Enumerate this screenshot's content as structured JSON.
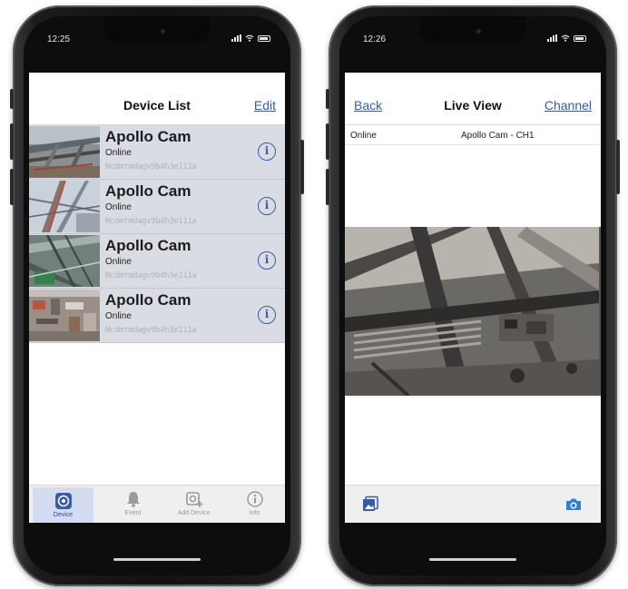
{
  "left_phone": {
    "status_time": "12:25",
    "nav": {
      "title": "Device List",
      "edit_label": "Edit"
    },
    "devices": [
      {
        "name": "Apollo Cam",
        "status": "Online",
        "id": "Ncdmtmdagv9b4h3e111a",
        "thumb_icon": "construction-scaffold-thumbnail"
      },
      {
        "name": "Apollo Cam",
        "status": "Online",
        "id": "Ncdmtmdagv9b4h3e111a",
        "thumb_icon": "tower-crane-thumbnail"
      },
      {
        "name": "Apollo Cam",
        "status": "Online",
        "id": "Ncdmtmdagv9b4h3e111a",
        "thumb_icon": "steel-beams-thumbnail"
      },
      {
        "name": "Apollo Cam",
        "status": "Online",
        "id": "Ncdmtmdagv9b4h3e111a",
        "thumb_icon": "aerial-site-thumbnail"
      }
    ],
    "tabs": [
      {
        "label": "Device",
        "icon": "device-camera-icon",
        "active": true
      },
      {
        "label": "Event",
        "icon": "bell-icon",
        "active": false
      },
      {
        "label": "Add Device",
        "icon": "add-device-icon",
        "active": false
      },
      {
        "label": "Info",
        "icon": "info-icon",
        "active": false
      }
    ]
  },
  "right_phone": {
    "status_time": "12:26",
    "nav": {
      "back_label": "Back",
      "title": "Live View",
      "channel_label": "Channel"
    },
    "status_line": {
      "status": "Online",
      "camera": "Apollo Cam - CH1"
    },
    "toolbar": {
      "left_icon": "snapshot-gallery-icon",
      "right_icon": "camera-icon"
    }
  },
  "colors": {
    "accent": "#3a5ba8",
    "row_background": "#d9dde3",
    "active_tab": "#d3dcf0"
  }
}
